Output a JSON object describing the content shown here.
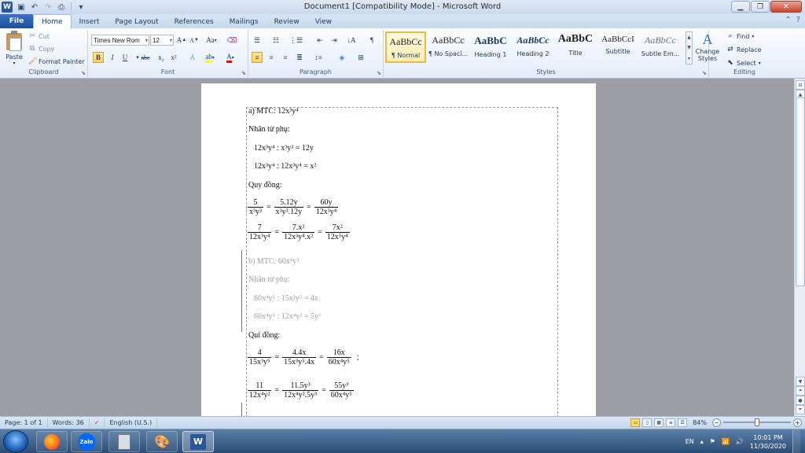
{
  "window": {
    "title": "Document1 [Compatibility Mode] - Microsoft Word",
    "app_icon": "word-icon"
  },
  "quick_access": [
    "save-icon",
    "undo-icon",
    "redo-icon",
    "print-preview-icon"
  ],
  "tabs": [
    "File",
    "Home",
    "Insert",
    "Page Layout",
    "References",
    "Mailings",
    "Review",
    "View"
  ],
  "active_tab": "Home",
  "clipboard": {
    "paste": "Paste",
    "cut": "Cut",
    "copy": "Copy",
    "format_painter": "Format Painter",
    "group_label": "Clipboard"
  },
  "font": {
    "name": "Times New Rom",
    "size": "12",
    "group_label": "Font",
    "grow": "A",
    "shrink": "A",
    "change_case": "Aa",
    "bold": "B",
    "italic": "I",
    "underline": "U",
    "strike": "abc",
    "subscript": "x₂",
    "superscript": "x²",
    "text_effects": "A",
    "font_color": "A",
    "highlight_color": "#ffff00",
    "font_color_value": "#ff0000"
  },
  "paragraph": {
    "group_label": "Paragraph",
    "show_marks": "¶"
  },
  "styles": {
    "group_label": "Styles",
    "items": [
      {
        "preview": "AaBbCc",
        "name": "¶ Normal"
      },
      {
        "preview": "AaBbCc",
        "name": "¶ No Spaci..."
      },
      {
        "preview": "AaBbC",
        "name": "Heading 1"
      },
      {
        "preview": "AaBbCc",
        "name": "Heading 2"
      },
      {
        "preview": "AaBbC",
        "name": "Title"
      },
      {
        "preview": "AaBbCcI",
        "name": "Subtitle"
      },
      {
        "preview": "AaBbCc",
        "name": "Subtle Em..."
      }
    ],
    "change_styles": "Change Styles"
  },
  "editing": {
    "group_label": "Editing",
    "find": "Find",
    "replace": "Replace",
    "select": "Select"
  },
  "document": {
    "a_header": "a) MTC: 12x³y⁴",
    "a_nhan_tu": "Nhân tử phụ:",
    "a_nt1": "12x³y⁴ : x³y³ = 12y",
    "a_nt2": "12x³y⁴ : 12x³y⁴ = x²",
    "a_quy_dong": "Quy đồng:",
    "a_eq1": {
      "f1_n": "5",
      "f1_d": "x³y³",
      "f2_n": "5.12y",
      "f2_d": "x³y³.12y",
      "f3_n": "60y",
      "f3_d": "12x³y⁴"
    },
    "a_eq2": {
      "f1_n": "7",
      "f1_d": "12x³y⁴",
      "f2_n": "7.x²",
      "f2_d": "12x³y⁴.x²",
      "f3_n": "7x²",
      "f3_d": "12x⁵y⁴"
    },
    "b_header_label": "b) MTC: ",
    "b_header_value": "60x⁴y⁵",
    "b_nhan_tu": "Nhân tử phụ:",
    "b_nt1": "60x⁴y⁵ : 15x³y⁵ = 4x",
    "b_nt2": "60x⁴y⁵ : 12x⁴y² = 5y³",
    "b_qui_dong": "Qui đồng:",
    "b_eq1": {
      "f1_n": "4",
      "f1_d": "15x³y⁵",
      "f2_n": "4.4x",
      "f2_d": "15x³y⁵.4x",
      "f3_n": "16x",
      "f3_d": "60x⁴y⁵",
      "tail": ";"
    },
    "b_eq2": {
      "f1_n": "11",
      "f1_d": "12x⁴y²",
      "f2_n": "11.5y³",
      "f2_d": "12x⁴y².5y³",
      "f3_n": "55y³",
      "f3_d": "60x⁴y⁵"
    },
    "equals": "="
  },
  "status": {
    "page": "Page: 1 of 1",
    "words": "Words: 36",
    "language": "English (U.S.)",
    "zoom": "84%"
  },
  "taskbar": {
    "apps": [
      "firefox-icon",
      "zalo-icon",
      "calculator-icon",
      "paint-icon",
      "word-icon"
    ],
    "zalo_label": "Zalo",
    "word_label": "W",
    "lang": "EN",
    "time": "10:01 PM",
    "date": "11/30/2020"
  }
}
